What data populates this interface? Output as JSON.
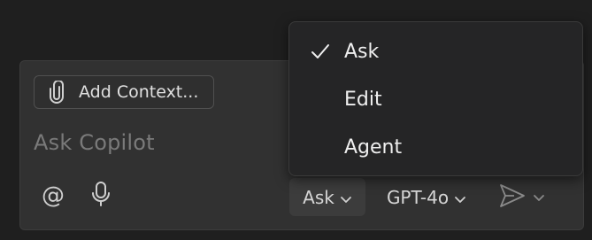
{
  "chat": {
    "add_context_label": "Add Context...",
    "placeholder": "Ask Copilot",
    "mode_label": "Ask",
    "model_label": "GPT-4o"
  },
  "menu": {
    "items": [
      {
        "label": "Ask",
        "selected": true
      },
      {
        "label": "Edit",
        "selected": false
      },
      {
        "label": "Agent",
        "selected": false
      }
    ]
  },
  "icons": {
    "attach": "paperclip-icon",
    "mention": "at-sign-icon",
    "voice": "microphone-icon",
    "send": "send-icon",
    "chevron": "chevron-down-icon",
    "check": "check-icon"
  },
  "colors": {
    "background": "#1f1f1f",
    "panel": "#313131",
    "menu": "#252526",
    "text": "#e0e0e0",
    "placeholder": "#7a7a7a"
  }
}
